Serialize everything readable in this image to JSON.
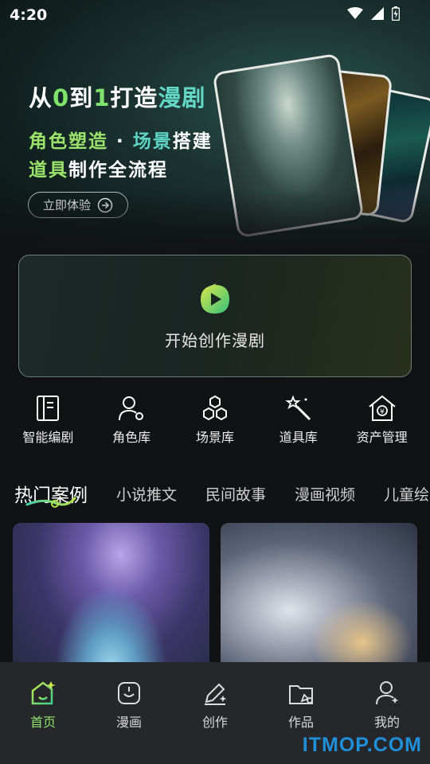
{
  "status_bar": {
    "time": "4:20"
  },
  "hero": {
    "line1_a": "从",
    "line1_b": "0",
    "line1_c": "到",
    "line1_d": "1",
    "line1_e": "打造",
    "line1_f": "漫剧",
    "line2_a": "角色塑造",
    "line2_dot": " · ",
    "line2_b": "场景",
    "line2_c": "搭建",
    "line3_a": "道具",
    "line3_b": "制作全流程",
    "try_button": "立即体验"
  },
  "start_card": {
    "label": "开始创作漫剧"
  },
  "tools": [
    {
      "label": "智能编剧",
      "icon": "script-book-icon"
    },
    {
      "label": "角色库",
      "icon": "character-icon"
    },
    {
      "label": "场景库",
      "icon": "hexagons-icon"
    },
    {
      "label": "道具库",
      "icon": "magic-wand-icon"
    },
    {
      "label": "资产管理",
      "icon": "asset-home-icon"
    }
  ],
  "tabs": [
    "热门案例",
    "小说推文",
    "民间故事",
    "漫画视频",
    "儿童绘"
  ],
  "bottom_nav": [
    {
      "label": "首页",
      "icon": "home-icon",
      "active": true
    },
    {
      "label": "漫画",
      "icon": "comic-icon",
      "active": false
    },
    {
      "label": "创作",
      "icon": "pen-icon",
      "active": false
    },
    {
      "label": "作品",
      "icon": "folder-icon",
      "active": false
    },
    {
      "label": "我的",
      "icon": "profile-icon",
      "active": false
    }
  ],
  "colors": {
    "accent_green": "#8de26b",
    "accent_teal": "#5fd5c6",
    "nav_bg": "#26272a"
  },
  "watermark": "ITMOP.COM"
}
